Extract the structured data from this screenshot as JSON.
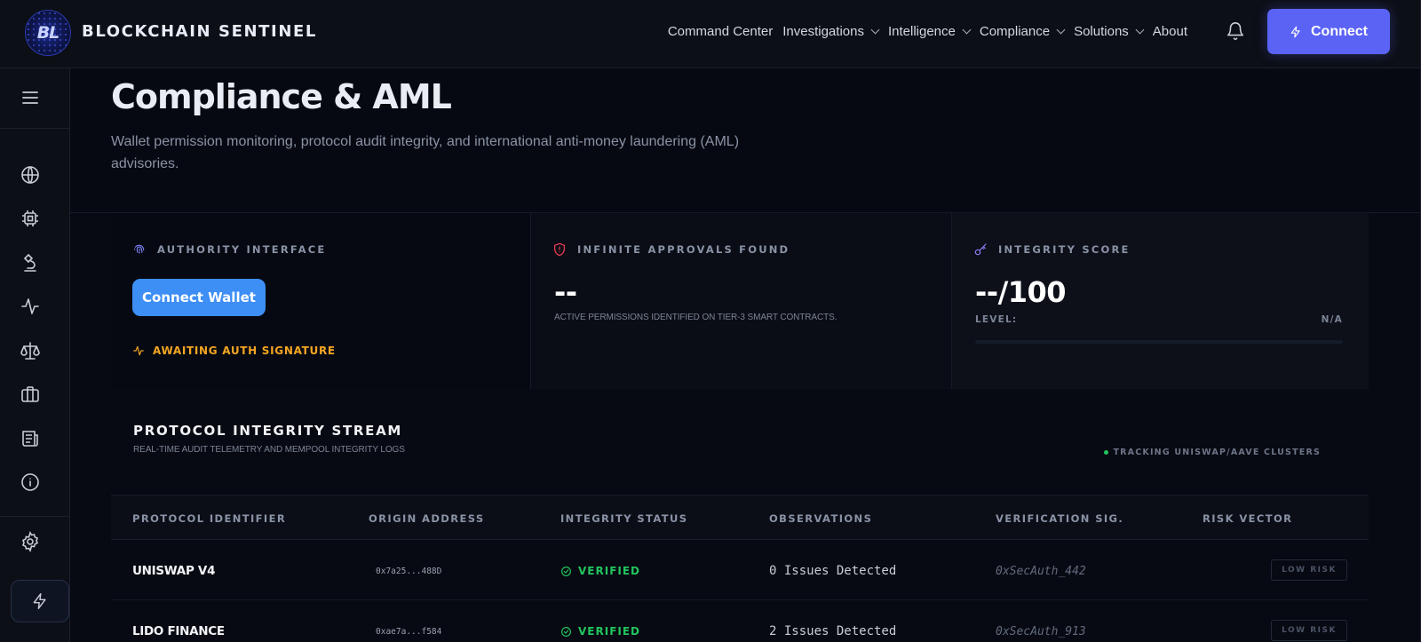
{
  "header": {
    "logo_text": "BL",
    "brand": "BLOCKCHAIN SENTINEL",
    "nav": [
      {
        "label": "Command Center",
        "dropdown": false
      },
      {
        "label": "Investigations",
        "dropdown": true
      },
      {
        "label": "Intelligence",
        "dropdown": true
      },
      {
        "label": "Compliance",
        "dropdown": true
      },
      {
        "label": "Solutions",
        "dropdown": true
      },
      {
        "label": "About",
        "dropdown": false
      }
    ],
    "connect_label": "Connect",
    "accent_color": "#5b63f5"
  },
  "sidebar": {
    "icons": [
      "globe-icon",
      "chip-icon",
      "microscope-icon",
      "activity-icon",
      "scale-icon",
      "briefcase-icon",
      "newspaper-icon",
      "info-icon",
      "gear-icon",
      "bolt-icon"
    ]
  },
  "hero": {
    "title": "Compliance & AML",
    "subtitle": "Wallet permission monitoring, protocol audit integrity, and international anti-money laundering (AML) advisories."
  },
  "cards": {
    "authority": {
      "label": "AUTHORITY INTERFACE",
      "button": "Connect Wallet",
      "status": "AWAITING AUTH SIGNATURE",
      "status_color": "#f5a623"
    },
    "approvals": {
      "label": "INFINITE APPROVALS FOUND",
      "value": "--",
      "note": "ACTIVE PERMISSIONS IDENTIFIED ON TIER-3 SMART CONTRACTS."
    },
    "integrity": {
      "label": "INTEGRITY SCORE",
      "value": "--/100",
      "level_label": "LEVEL:",
      "level_value": "N/A"
    }
  },
  "stream": {
    "title": "PROTOCOL INTEGRITY STREAM",
    "subtitle": "REAL-TIME AUDIT TELEMETRY AND MEMPOOL INTEGRITY LOGS",
    "tracking": "TRACKING UNISWAP/AAVE CLUSTERS",
    "columns": [
      "PROTOCOL IDENTIFIER",
      "ORIGIN ADDRESS",
      "INTEGRITY STATUS",
      "OBSERVATIONS",
      "VERIFICATION SIG.",
      "RISK VECTOR"
    ],
    "rows": [
      {
        "protocol": "UNISWAP V4",
        "address": "0x7a25...488D",
        "status": "VERIFIED",
        "observations": "0 Issues Detected",
        "signature": "0xSecAuth_442",
        "risk": "LOW RISK"
      },
      {
        "protocol": "LIDO FINANCE",
        "address": "0xae7a...f584",
        "status": "VERIFIED",
        "observations": "2 Issues Detected",
        "signature": "0xSecAuth_913",
        "risk": "LOW RISK"
      }
    ],
    "status_color": "#22c55e"
  }
}
